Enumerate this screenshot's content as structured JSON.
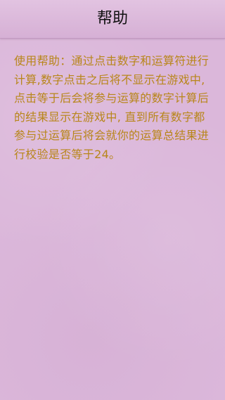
{
  "header": {
    "title": "帮助"
  },
  "content": {
    "help_text": "使用帮助：通过点击数字和运算符进行计算,数字点击之后将不显示在游戏中,点击等于后会将参与运算的数字计算后的结果显示在游戏中, 直到所有数字都参与过运算后将会就你的运算总结果进行校验是否等于24。"
  },
  "colors": {
    "background": "#dbb7da",
    "text_accent": "#b8861a",
    "title_text": "#111111"
  }
}
